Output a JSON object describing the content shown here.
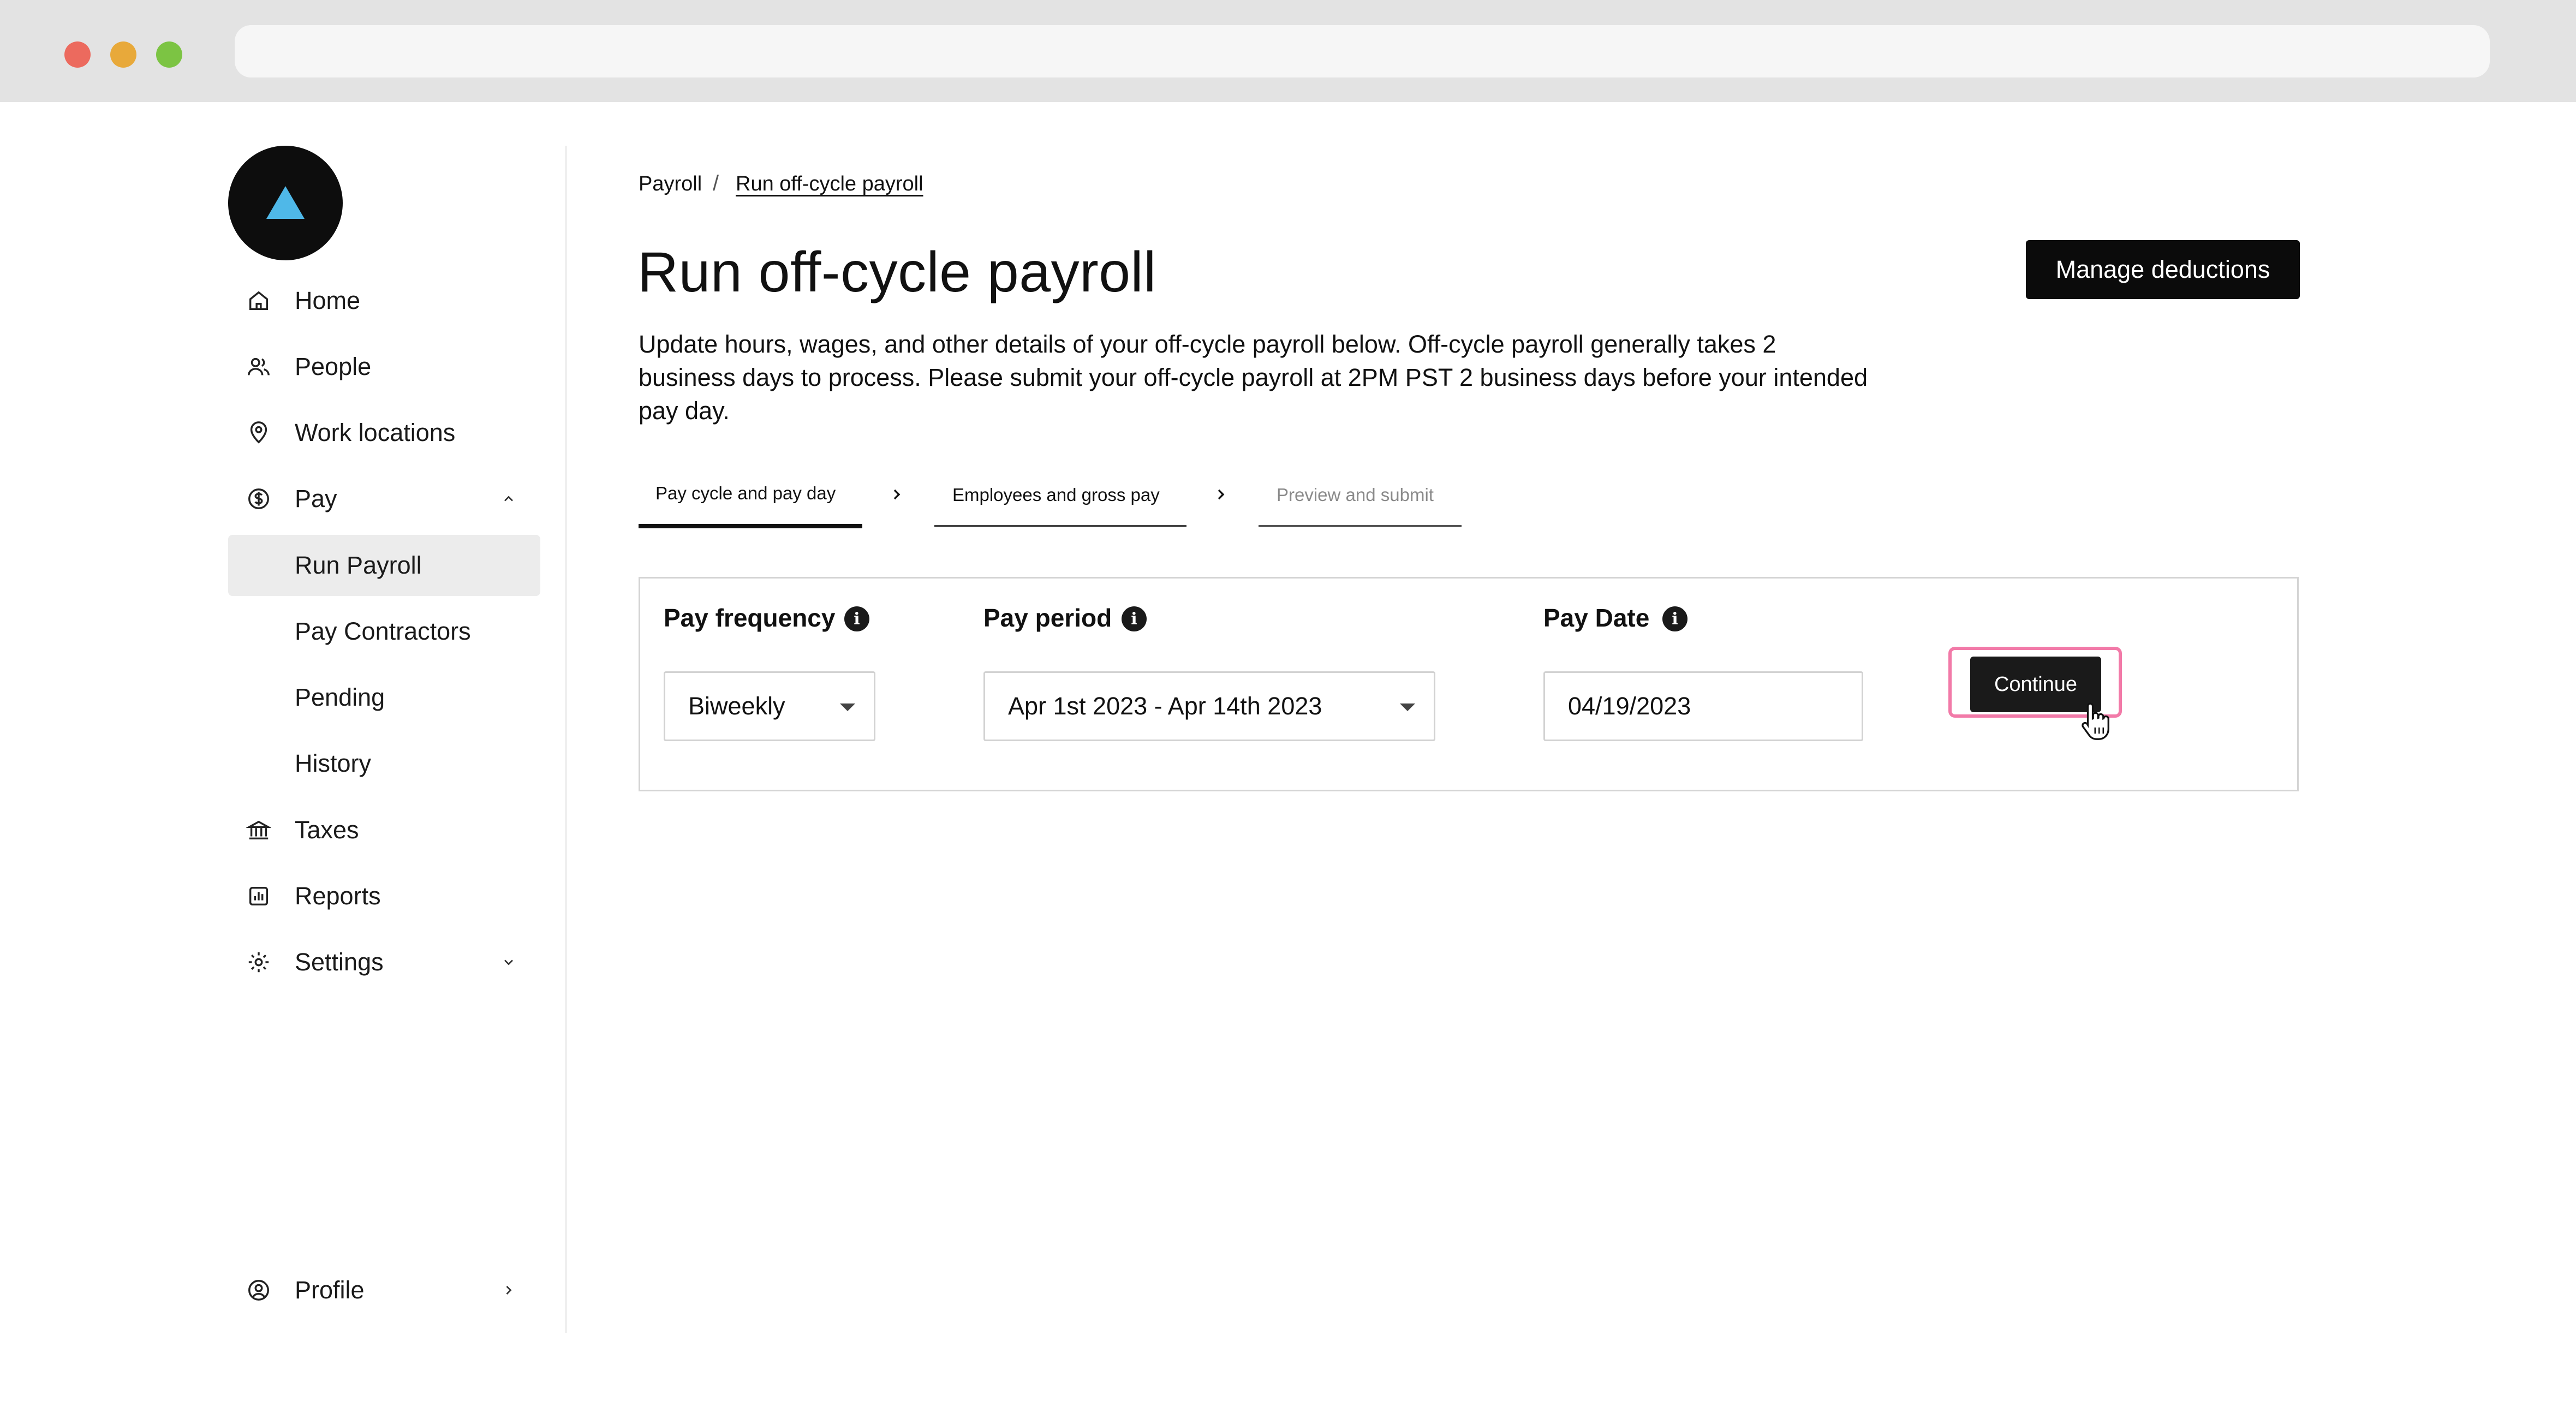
{
  "sidebar": {
    "items": [
      {
        "label": "Home",
        "icon": "home-icon"
      },
      {
        "label": "People",
        "icon": "people-icon"
      },
      {
        "label": "Work locations",
        "icon": "location-pin-icon"
      },
      {
        "label": "Pay",
        "icon": "dollar-circle-icon",
        "expanded": true
      },
      {
        "label": "Run Payroll",
        "active": true
      },
      {
        "label": "Pay Contractors"
      },
      {
        "label": "Pending"
      },
      {
        "label": "History"
      },
      {
        "label": "Taxes",
        "icon": "bank-icon"
      },
      {
        "label": "Reports",
        "icon": "reports-icon"
      },
      {
        "label": "Settings",
        "icon": "gear-icon"
      }
    ],
    "profile_label": "Profile"
  },
  "breadcrumb": {
    "root": "Payroll",
    "separator": "/",
    "current": "Run off-cycle payroll"
  },
  "page": {
    "title": "Run off-cycle payroll",
    "description": "Update hours, wages, and other details of your off-cycle payroll below. Off-cycle payroll generally takes 2 business days to process. Please submit your off-cycle payroll at 2PM PST 2 business days before your intended pay day.",
    "manage_button": "Manage deductions"
  },
  "steps": [
    {
      "label": "Pay cycle and pay day",
      "state": "active"
    },
    {
      "label": "Employees and gross pay",
      "state": "pending"
    },
    {
      "label": "Preview and submit",
      "state": "disabled"
    }
  ],
  "form": {
    "pay_frequency": {
      "label": "Pay frequency",
      "value": "Biweekly"
    },
    "pay_period": {
      "label": "Pay period",
      "value": "Apr 1st 2023 - Apr 14th 2023"
    },
    "pay_date": {
      "label": "Pay Date",
      "value": "04/19/2023"
    },
    "info_glyph": "i",
    "continue_label": "Continue"
  },
  "colors": {
    "accent_highlight": "#f27aa8",
    "logo_triangle": "#4fb8e8",
    "primary_button": "#0b0b0b"
  }
}
